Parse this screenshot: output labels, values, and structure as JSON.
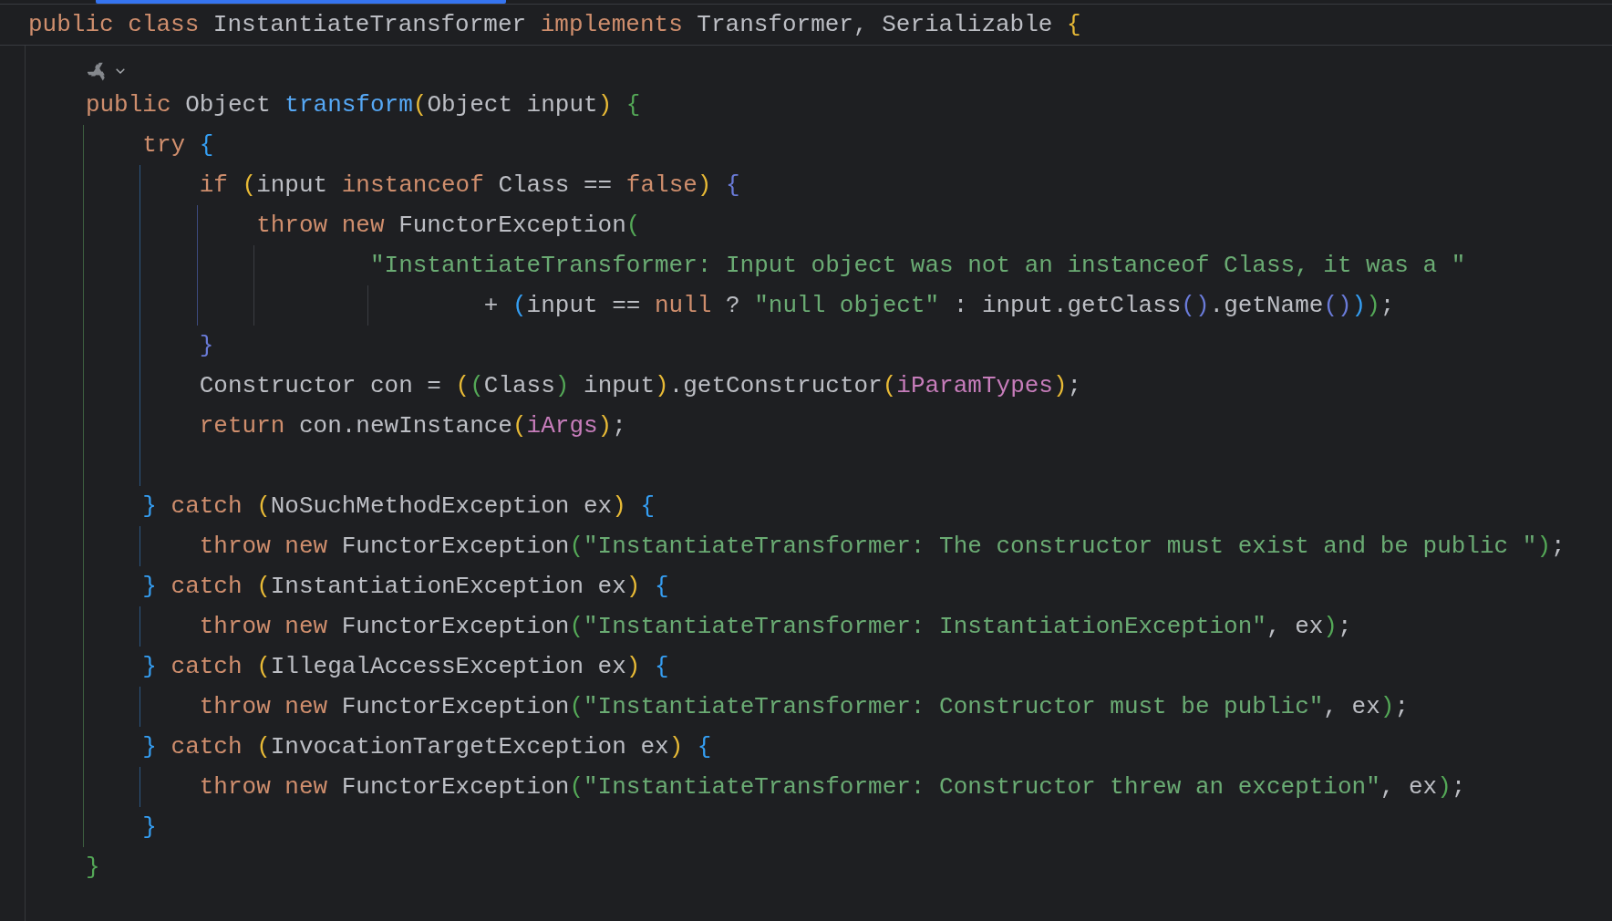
{
  "sticky_header": {
    "tokens": [
      {
        "text": "public class ",
        "kind": "keyword"
      },
      {
        "text": "InstantiateTransformer ",
        "kind": "plain"
      },
      {
        "text": "implements ",
        "kind": "keyword"
      },
      {
        "text": "Transformer, Serializable ",
        "kind": "plain"
      },
      {
        "text": "{",
        "kind": "bracket",
        "color": "#e8ba36"
      }
    ]
  },
  "lines": [
    {
      "kind": "statement",
      "inlay_hint": true,
      "tokens": [
        {
          "text": "public ",
          "kind": "keyword"
        },
        {
          "text": "Object ",
          "kind": "plain"
        },
        {
          "text": "transform",
          "kind": "function"
        },
        {
          "text": "(",
          "kind": "bracket",
          "color": "#e8ba36"
        },
        {
          "text": "Object input",
          "kind": "plain"
        },
        {
          "text": ")",
          "kind": "bracket",
          "color": "#e8ba36"
        },
        {
          "text": " {",
          "kind": "bracket",
          "color": "#54a857"
        }
      ],
      "guide": {
        "color": "#3e5f40"
      },
      "children": [
        {
          "kind": "statement",
          "tokens": [
            {
              "text": "try",
              "kind": "keyword"
            },
            {
              "text": " {",
              "kind": "bracket",
              "color": "#359ff4"
            }
          ],
          "guide": {
            "color": "#2c5783"
          },
          "children": [
            {
              "kind": "statement",
              "tokens": [
                {
                  "text": "if ",
                  "kind": "keyword"
                },
                {
                  "text": "(",
                  "kind": "bracket",
                  "color": "#e8ba36"
                },
                {
                  "text": "input ",
                  "kind": "plain"
                },
                {
                  "text": "instanceof ",
                  "kind": "keyword"
                },
                {
                  "text": "Class == ",
                  "kind": "plain"
                },
                {
                  "text": "false",
                  "kind": "keyword"
                },
                {
                  "text": ")",
                  "kind": "bracket",
                  "color": "#e8ba36"
                },
                {
                  "text": " {",
                  "kind": "bracket",
                  "color": "#6a7bd9"
                }
              ],
              "guide": {
                "color": "#3d4a7e"
              },
              "children": [
                {
                  "kind": "statement",
                  "tokens": [
                    {
                      "text": "throw new ",
                      "kind": "keyword"
                    },
                    {
                      "text": "FunctorException",
                      "kind": "plain"
                    },
                    {
                      "text": "(",
                      "kind": "bracket",
                      "color": "#54a857"
                    }
                  ],
                  "guide": {
                    "color": "#3b3d42"
                  },
                  "children": [
                    {
                      "kind": "continuation",
                      "tokens": [
                        {
                          "text": "\"InstantiateTransformer: Input object was not an instanceof Class, it was a \"",
                          "kind": "string"
                        }
                      ],
                      "guide": {
                        "color": "#3b3d42"
                      },
                      "children": [
                        {
                          "kind": "continuation",
                          "tokens": [
                            {
                              "text": "+ ",
                              "kind": "plain"
                            },
                            {
                              "text": "(",
                              "kind": "bracket",
                              "color": "#359ff4"
                            },
                            {
                              "text": "input == ",
                              "kind": "plain"
                            },
                            {
                              "text": "null",
                              "kind": "keyword"
                            },
                            {
                              "text": " ? ",
                              "kind": "plain"
                            },
                            {
                              "text": "\"null object\"",
                              "kind": "string"
                            },
                            {
                              "text": " : input.getClass",
                              "kind": "plain"
                            },
                            {
                              "text": "()",
                              "kind": "bracket",
                              "color": "#6a7bd9"
                            },
                            {
                              "text": ".getName",
                              "kind": "plain"
                            },
                            {
                              "text": "()",
                              "kind": "bracket",
                              "color": "#6a7bd9"
                            },
                            {
                              "text": ")",
                              "kind": "bracket",
                              "color": "#359ff4"
                            },
                            {
                              "text": ")",
                              "kind": "bracket",
                              "color": "#54a857"
                            },
                            {
                              "text": ";",
                              "kind": "plain"
                            }
                          ]
                        }
                      ]
                    }
                  ]
                }
              ]
            },
            {
              "kind": "statement",
              "tokens": [
                {
                  "text": "}",
                  "kind": "bracket",
                  "color": "#6a7bd9"
                }
              ]
            },
            {
              "kind": "statement",
              "tokens": [
                {
                  "text": "Constructor con = ",
                  "kind": "plain"
                },
                {
                  "text": "(",
                  "kind": "bracket",
                  "color": "#e8ba36"
                },
                {
                  "text": "(",
                  "kind": "bracket",
                  "color": "#54a857"
                },
                {
                  "text": "Class",
                  "kind": "plain"
                },
                {
                  "text": ")",
                  "kind": "bracket",
                  "color": "#54a857"
                },
                {
                  "text": " input",
                  "kind": "plain"
                },
                {
                  "text": ")",
                  "kind": "bracket",
                  "color": "#e8ba36"
                },
                {
                  "text": ".getConstructor",
                  "kind": "plain"
                },
                {
                  "text": "(",
                  "kind": "bracket",
                  "color": "#e8ba36"
                },
                {
                  "text": "iParamTypes",
                  "kind": "field"
                },
                {
                  "text": ")",
                  "kind": "bracket",
                  "color": "#e8ba36"
                },
                {
                  "text": ";",
                  "kind": "plain"
                }
              ]
            },
            {
              "kind": "statement",
              "tokens": [
                {
                  "text": "return ",
                  "kind": "keyword"
                },
                {
                  "text": "con.newInstance",
                  "kind": "plain"
                },
                {
                  "text": "(",
                  "kind": "bracket",
                  "color": "#e8ba36"
                },
                {
                  "text": "iArgs",
                  "kind": "field"
                },
                {
                  "text": ")",
                  "kind": "bracket",
                  "color": "#e8ba36"
                },
                {
                  "text": ";",
                  "kind": "plain"
                }
              ]
            },
            {
              "kind": "blank"
            }
          ]
        },
        {
          "kind": "statement",
          "tokens": [
            {
              "text": "}",
              "kind": "bracket",
              "color": "#359ff4"
            },
            {
              "text": " catch ",
              "kind": "keyword"
            },
            {
              "text": "(",
              "kind": "bracket",
              "color": "#e8ba36"
            },
            {
              "text": "NoSuchMethodException ex",
              "kind": "plain"
            },
            {
              "text": ")",
              "kind": "bracket",
              "color": "#e8ba36"
            },
            {
              "text": " {",
              "kind": "bracket",
              "color": "#359ff4"
            }
          ],
          "guide": {
            "color": "#2c5783"
          },
          "children": [
            {
              "kind": "statement",
              "tokens": [
                {
                  "text": "throw new ",
                  "kind": "keyword"
                },
                {
                  "text": "FunctorException",
                  "kind": "plain"
                },
                {
                  "text": "(",
                  "kind": "bracket",
                  "color": "#54a857"
                },
                {
                  "text": "\"InstantiateTransformer: The constructor must exist and be public \"",
                  "kind": "string"
                },
                {
                  "text": ")",
                  "kind": "bracket",
                  "color": "#54a857"
                },
                {
                  "text": ";",
                  "kind": "plain"
                }
              ]
            }
          ]
        },
        {
          "kind": "statement",
          "tokens": [
            {
              "text": "}",
              "kind": "bracket",
              "color": "#359ff4"
            },
            {
              "text": " catch ",
              "kind": "keyword"
            },
            {
              "text": "(",
              "kind": "bracket",
              "color": "#e8ba36"
            },
            {
              "text": "InstantiationException ex",
              "kind": "plain"
            },
            {
              "text": ")",
              "kind": "bracket",
              "color": "#e8ba36"
            },
            {
              "text": " {",
              "kind": "bracket",
              "color": "#359ff4"
            }
          ],
          "guide": {
            "color": "#2c5783"
          },
          "children": [
            {
              "kind": "statement",
              "tokens": [
                {
                  "text": "throw new ",
                  "kind": "keyword"
                },
                {
                  "text": "FunctorException",
                  "kind": "plain"
                },
                {
                  "text": "(",
                  "kind": "bracket",
                  "color": "#54a857"
                },
                {
                  "text": "\"InstantiateTransformer: InstantiationException\"",
                  "kind": "string"
                },
                {
                  "text": ", ex",
                  "kind": "plain"
                },
                {
                  "text": ")",
                  "kind": "bracket",
                  "color": "#54a857"
                },
                {
                  "text": ";",
                  "kind": "plain"
                }
              ]
            }
          ]
        },
        {
          "kind": "statement",
          "tokens": [
            {
              "text": "}",
              "kind": "bracket",
              "color": "#359ff4"
            },
            {
              "text": " catch ",
              "kind": "keyword"
            },
            {
              "text": "(",
              "kind": "bracket",
              "color": "#e8ba36"
            },
            {
              "text": "IllegalAccessException ex",
              "kind": "plain"
            },
            {
              "text": ")",
              "kind": "bracket",
              "color": "#e8ba36"
            },
            {
              "text": " {",
              "kind": "bracket",
              "color": "#359ff4"
            }
          ],
          "guide": {
            "color": "#2c5783"
          },
          "children": [
            {
              "kind": "statement",
              "tokens": [
                {
                  "text": "throw new ",
                  "kind": "keyword"
                },
                {
                  "text": "FunctorException",
                  "kind": "plain"
                },
                {
                  "text": "(",
                  "kind": "bracket",
                  "color": "#54a857"
                },
                {
                  "text": "\"InstantiateTransformer: Constructor must be public\"",
                  "kind": "string"
                },
                {
                  "text": ", ex",
                  "kind": "plain"
                },
                {
                  "text": ")",
                  "kind": "bracket",
                  "color": "#54a857"
                },
                {
                  "text": ";",
                  "kind": "plain"
                }
              ]
            }
          ]
        },
        {
          "kind": "statement",
          "tokens": [
            {
              "text": "}",
              "kind": "bracket",
              "color": "#359ff4"
            },
            {
              "text": " catch ",
              "kind": "keyword"
            },
            {
              "text": "(",
              "kind": "bracket",
              "color": "#e8ba36"
            },
            {
              "text": "InvocationTargetException ex",
              "kind": "plain"
            },
            {
              "text": ")",
              "kind": "bracket",
              "color": "#e8ba36"
            },
            {
              "text": " {",
              "kind": "bracket",
              "color": "#359ff4"
            }
          ],
          "guide": {
            "color": "#2c5783"
          },
          "children": [
            {
              "kind": "statement",
              "tokens": [
                {
                  "text": "throw new ",
                  "kind": "keyword"
                },
                {
                  "text": "FunctorException",
                  "kind": "plain"
                },
                {
                  "text": "(",
                  "kind": "bracket",
                  "color": "#54a857"
                },
                {
                  "text": "\"InstantiateTransformer: Constructor threw an exception\"",
                  "kind": "string"
                },
                {
                  "text": ", ex",
                  "kind": "plain"
                },
                {
                  "text": ")",
                  "kind": "bracket",
                  "color": "#54a857"
                },
                {
                  "text": ";",
                  "kind": "plain"
                }
              ]
            }
          ]
        },
        {
          "kind": "statement",
          "tokens": [
            {
              "text": "}",
              "kind": "bracket",
              "color": "#359ff4"
            }
          ]
        }
      ]
    },
    {
      "kind": "statement",
      "tokens": [
        {
          "text": "}",
          "kind": "bracket",
          "color": "#54a857"
        }
      ]
    }
  ]
}
